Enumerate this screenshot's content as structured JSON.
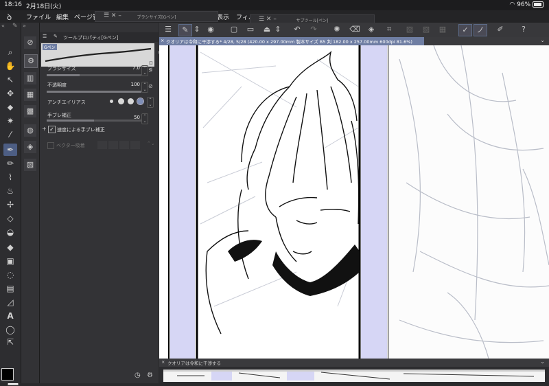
{
  "status": {
    "time": "18:16",
    "date": "2月18日(火)",
    "battery": "96%"
  },
  "menu": [
    "ファイル",
    "編集",
    "ページ管",
    "表示",
    "フィル"
  ],
  "floating_palettes": {
    "brush_size": "ブラシサイズ[Gペン]",
    "sub_tool": "サブツール[ペン]"
  },
  "tool_property": {
    "header": "ツールプロパティ[Gペン]",
    "preset_label": "Gペン",
    "brush_size": {
      "label": "ブラシサイズ",
      "value": "7.0",
      "level": 0.35
    },
    "opacity": {
      "label": "不透明度",
      "value": "100",
      "level": 1.0
    },
    "antialias": {
      "label": "アンチエイリアス"
    },
    "stabilization": {
      "label": "手ブレ補正",
      "value": "50",
      "level": 0.5
    },
    "speed_stabilization": {
      "label": "速度による手ブレ補正",
      "checked": true
    },
    "vector_snap": {
      "label": "ベクター吸着"
    }
  },
  "canvas_tab": "クオリアは令和に干渉する* 4/28, 5/28 (420.00 x 297.00mm 製本サイズ B5 判 182.00 x 257.00mm 600dpi 81.6%)",
  "navigator_title": "クオリアは令和に干渉する",
  "colors": {
    "main": "#000000",
    "sub": "#ffffff",
    "accent": "#6f7ea3",
    "active_tool": "#4d5e84",
    "panel_fill": "#d6d6f5"
  }
}
